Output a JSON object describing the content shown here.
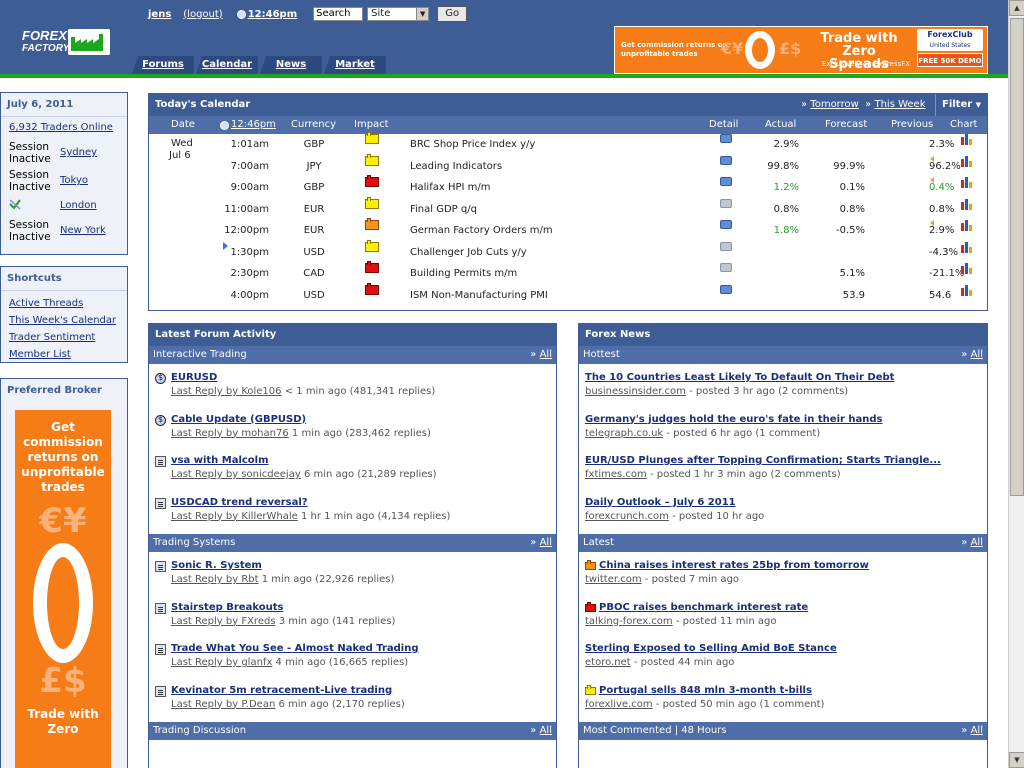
{
  "header": {
    "user": "jens",
    "logout": "(logout)",
    "time": "12:46pm",
    "search_label": "Search",
    "site_select": "Site",
    "go_label": "Go",
    "nav": [
      "Forums",
      "Calendar",
      "News",
      "Market"
    ],
    "logo_line1": "FOREX",
    "logo_line2": "FACTORY",
    "ad": {
      "text1": "Get commission returns on unprofitable trades",
      "headline": "Trade with Zero Spreads",
      "sub": "Exclusively on ExpressFX",
      "brand": "ForexClub",
      "brand_sub": "United States",
      "demo": "FREE 50K DEMO",
      "currency_left": "€¥",
      "currency_right": "£$"
    }
  },
  "sidebar": {
    "date": "July 6, 2011",
    "traders_online": "6,932 Traders Online",
    "sessions": [
      {
        "status": "Session Inactive",
        "city": "Sydney"
      },
      {
        "status": "Session Inactive",
        "city": "Tokyo"
      },
      {
        "status": "",
        "city": "London"
      },
      {
        "status": "Session Inactive",
        "city": "New York"
      }
    ],
    "shortcuts_title": "Shortcuts",
    "shortcuts": [
      "Active Threads",
      "This Week's Calendar",
      "Trader Sentiment",
      "Member List"
    ],
    "broker_title": "Preferred Broker",
    "broker_ad": {
      "text": "Get commission returns on unprofitable trades",
      "cur1": "€¥",
      "cur2": "£$",
      "text2": "Trade with Zero"
    }
  },
  "calendar": {
    "title": "Today's Calendar",
    "tomorrow": "Tomorrow",
    "this_week": "This Week",
    "filter": "Filter",
    "columns": [
      "Date",
      "12:46pm",
      "Currency",
      "Impact",
      "Detail",
      "Actual",
      "Forecast",
      "Previous",
      "Chart"
    ],
    "date_day": "Wed",
    "date_date": "Jul 6",
    "rows": [
      {
        "time": "1:01am",
        "cur": "GBP",
        "impact": "y",
        "event": "BRC Shop Price Index y/y",
        "detail": "b",
        "actual": "2.9%",
        "forecast": "",
        "previous": "2.3%",
        "prev_arrow": false,
        "actual_green": false,
        "prev_green": false
      },
      {
        "time": "7:00am",
        "cur": "JPY",
        "impact": "y",
        "event": "Leading Indicators",
        "detail": "b",
        "actual": "99.8%",
        "forecast": "99.9%",
        "previous": "96.2%",
        "prev_arrow": true,
        "actual_green": false,
        "prev_green": false
      },
      {
        "time": "9:00am",
        "cur": "GBP",
        "impact": "r",
        "event": "Halifax HPI m/m",
        "detail": "b",
        "actual": "1.2%",
        "forecast": "0.1%",
        "previous": "0.4%",
        "prev_arrow": true,
        "actual_green": true,
        "prev_green": true
      },
      {
        "time": "11:00am",
        "cur": "EUR",
        "impact": "y",
        "event": "Final GDP q/q",
        "detail": "g",
        "actual": "0.8%",
        "forecast": "0.8%",
        "previous": "0.8%",
        "prev_arrow": false,
        "actual_green": false,
        "prev_green": false
      },
      {
        "time": "12:00pm",
        "cur": "EUR",
        "impact": "o",
        "event": "German Factory Orders m/m",
        "detail": "b",
        "actual": "1.8%",
        "forecast": "-0.5%",
        "previous": "2.9%",
        "prev_arrow": true,
        "actual_green": true,
        "prev_green": false
      },
      {
        "time": "1:30pm",
        "cur": "USD",
        "impact": "y",
        "event": "Challenger Job Cuts y/y",
        "detail": "g",
        "actual": "",
        "forecast": "",
        "previous": "-4.3%",
        "prev_arrow": false,
        "actual_green": false,
        "prev_green": false,
        "next": true
      },
      {
        "time": "2:30pm",
        "cur": "CAD",
        "impact": "r",
        "event": "Building Permits m/m",
        "detail": "g",
        "actual": "",
        "forecast": "5.1%",
        "previous": "-21.1%",
        "prev_arrow": false,
        "actual_green": false,
        "prev_green": false
      },
      {
        "time": "4:00pm",
        "cur": "USD",
        "impact": "r",
        "event": "ISM Non-Manufacturing PMI",
        "detail": "b",
        "actual": "",
        "forecast": "53.9",
        "previous": "54.6",
        "prev_arrow": false,
        "actual_green": false,
        "prev_green": false
      }
    ]
  },
  "forum": {
    "title": "Latest Forum Activity",
    "all": "All",
    "sections": [
      {
        "name": "Interactive Trading",
        "items": [
          {
            "icon": "globe",
            "title": "EURUSD",
            "by": "Last Reply by Kole106",
            "meta": "< 1 min ago (481,341 replies)"
          },
          {
            "icon": "globe",
            "title": "Cable Update (GBPUSD)",
            "by": "Last Reply by mohan76",
            "meta": "1 min ago (283,462 replies)"
          },
          {
            "icon": "doc",
            "title": "vsa with Malcolm",
            "by": "Last Reply by sonicdeejay",
            "meta": "6 min ago (21,289 replies)"
          },
          {
            "icon": "doc",
            "title": "USDCAD trend reversal?",
            "by": "Last Reply by KillerWhale",
            "meta": "1 hr 1 min ago (4,134 replies)"
          }
        ]
      },
      {
        "name": "Trading Systems",
        "items": [
          {
            "icon": "doc",
            "title": "Sonic R. System",
            "by": "Last Reply by Rbt",
            "meta": "1 min ago (22,926 replies)"
          },
          {
            "icon": "doc",
            "title": "Stairstep Breakouts",
            "by": "Last Reply by FXreds",
            "meta": "3 min ago (141 replies)"
          },
          {
            "icon": "doc",
            "title": "Trade What You See - Almost Naked Trading",
            "by": "Last Reply by glanfx",
            "meta": "4 min ago (16,665 replies)"
          },
          {
            "icon": "doc",
            "title": "Kevinator 5m retracement-Live trading",
            "by": "Last Reply by P.Dean",
            "meta": "6 min ago (2,170 replies)"
          }
        ]
      },
      {
        "name": "Trading Discussion",
        "items": []
      }
    ]
  },
  "news": {
    "title": "Forex News",
    "all": "All",
    "sections": [
      {
        "name": "Hottest",
        "items": [
          {
            "impact": "",
            "title": "The 10 Countries Least Likely To Default On Their Debt",
            "src": "businessinsider.com",
            "meta": "- posted 3 hr ago (2 comments)"
          },
          {
            "impact": "",
            "title": "Germany's judges hold the euro's fate in their hands",
            "src": "telegraph.co.uk",
            "meta": "- posted 6 hr ago (1 comment)"
          },
          {
            "impact": "",
            "title": "EUR/USD Plunges after Topping Confirmation; Starts Triangle...",
            "src": "fxtimes.com",
            "meta": "- posted 1 hr 3 min ago (2 comments)"
          },
          {
            "impact": "",
            "title": "Daily Outlook – July 6 2011",
            "src": "forexcrunch.com",
            "meta": "- posted 10 hr ago"
          }
        ]
      },
      {
        "name": "Latest",
        "items": [
          {
            "impact": "o",
            "title": "China raises interest rates 25bp from tomorrow",
            "src": "twitter.com",
            "meta": "- posted 7 min ago"
          },
          {
            "impact": "r",
            "title": "PBOC raises benchmark interest rate",
            "src": "talking-forex.com",
            "meta": "- posted 11 min ago"
          },
          {
            "impact": "",
            "title": "Sterling Exposed to Selling Amid BoE Stance",
            "src": "etoro.net",
            "meta": "- posted 44 min ago"
          },
          {
            "impact": "y",
            "title": "Portugal sells 848 mln 3-month t-bills",
            "src": "forexlive.com",
            "meta": "- posted 50 min ago (1 comment)"
          }
        ]
      },
      {
        "name": "Most Commented | 48 Hours",
        "items": []
      }
    ]
  },
  "colors": {
    "brand": "#3e5d95",
    "accent_green": "#1ea61e",
    "ad_orange": "#f57c16",
    "link": "#1a2f7a"
  }
}
